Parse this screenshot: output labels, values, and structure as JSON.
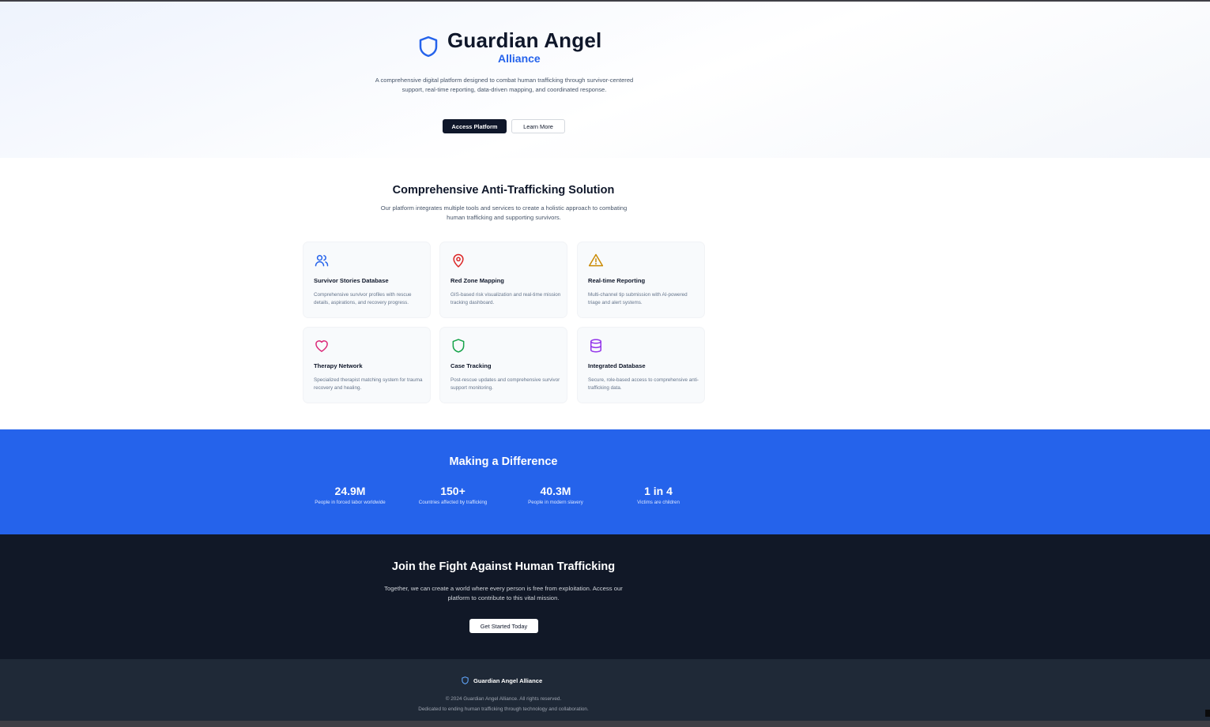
{
  "hero": {
    "title": "Guardian Angel",
    "subtitle": "Alliance",
    "shield_icon": "shield-icon",
    "description": "A comprehensive digital platform designed to combat human trafficking through survivor-centered support, real-time reporting, data-driven mapping, and coordinated response.",
    "primary_button": "Access Platform",
    "secondary_button": "Learn More",
    "brand_color": "#2563eb"
  },
  "features": {
    "title": "Comprehensive Anti-Trafficking Solution",
    "description": "Our platform integrates multiple tools and services to create a holistic approach to combating human trafficking and supporting survivors.",
    "cards": [
      {
        "icon": "users-icon",
        "color": "#2563eb",
        "title": "Survivor Stories Database",
        "description": "Comprehensive survivor profiles with rescue details, aspirations, and recovery progress."
      },
      {
        "icon": "map-pin-icon",
        "color": "#dc2626",
        "title": "Red Zone Mapping",
        "description": "GIS-based risk visualization and real-time mission tracking dashboard."
      },
      {
        "icon": "alert-triangle-icon",
        "color": "#ca8a04",
        "title": "Real-time Reporting",
        "description": "Multi-channel tip submission with AI-powered triage and alert systems."
      },
      {
        "icon": "heart-icon",
        "color": "#db2777",
        "title": "Therapy Network",
        "description": "Specialized therapist matching system for trauma recovery and healing."
      },
      {
        "icon": "shield-icon",
        "color": "#16a34a",
        "title": "Case Tracking",
        "description": "Post-rescue updates and comprehensive survivor support monitoring."
      },
      {
        "icon": "database-icon",
        "color": "#9333ea",
        "title": "Integrated Database",
        "description": "Secure, role-based access to comprehensive anti-trafficking data."
      }
    ]
  },
  "stats": {
    "title": "Making a Difference",
    "background": "#2563eb",
    "items": [
      {
        "value": "24.9M",
        "label": "People in forced labor worldwide"
      },
      {
        "value": "150+",
        "label": "Countries affected by trafficking"
      },
      {
        "value": "40.3M",
        "label": "People in modern slavery"
      },
      {
        "value": "1 in 4",
        "label": "Victims are children"
      }
    ]
  },
  "cta": {
    "title": "Join the Fight Against Human Trafficking",
    "description": "Together, we can create a world where every person is free from exploitation. Access our platform to contribute to this vital mission.",
    "button": "Get Started Today",
    "background": "#111827"
  },
  "footer": {
    "brand": "Guardian Angel Alliance",
    "copyright": "© 2024 Guardian Angel Alliance. All rights reserved.",
    "tagline": "Dedicated to ending human trafficking through technology and collaboration.",
    "background": "#1f2937"
  }
}
